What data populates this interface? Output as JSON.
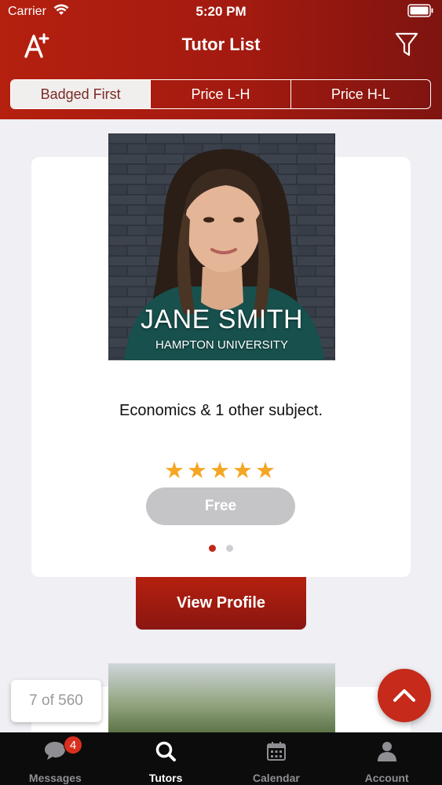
{
  "status_bar": {
    "carrier": "Carrier",
    "time": "5:20 PM"
  },
  "nav": {
    "title": "Tutor List"
  },
  "sort_segments": [
    {
      "label": "Badged First",
      "active": true
    },
    {
      "label": "Price L-H",
      "active": false
    },
    {
      "label": "Price H-L",
      "active": false
    }
  ],
  "tutor_card": {
    "name": "JANE SMITH",
    "school": "HAMPTON UNIVERSITY",
    "subjects": "Economics & 1 other subject.",
    "rating_stars": 5,
    "stars_text": "★★★★★",
    "price": "Free",
    "page_dots": 2,
    "active_dot": 0
  },
  "view_profile_label": "View Profile",
  "counter": "7 of 560",
  "tabbar": {
    "messages": {
      "label": "Messages",
      "badge": "4"
    },
    "tutors": {
      "label": "Tutors"
    },
    "calendar": {
      "label": "Calendar"
    },
    "account": {
      "label": "Account"
    }
  },
  "colors": {
    "brand_red": "#b5200f",
    "star": "#f5a623",
    "price_pill": "#c5c5c7",
    "tabbar_bg": "#0c0c0c"
  }
}
